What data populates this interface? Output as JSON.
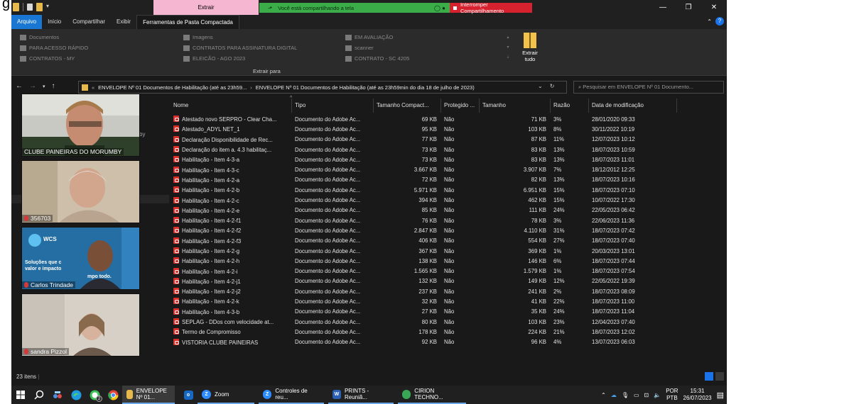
{
  "titlebar": {
    "context_tab": "Extrair",
    "sharing_text": "Você está compartilhando a tela",
    "stop_sharing": "Interromper Compartilhamento"
  },
  "ribbon_tabs": [
    "Arquivo",
    "Início",
    "Compartilhar",
    "Exibir",
    "Ferramentas de Pasta Compactada"
  ],
  "ribbon": {
    "locations_col1": [
      "Documentos",
      "PARA ACESSO RÁPIDO",
      "CONTRATOS - MY"
    ],
    "locations_col2": [
      "Imagens",
      "CONTRATOS PARA ASSINATURA DIGITAL",
      "ELEICÃO - AGO 2023"
    ],
    "locations_col3": [
      "EM AVALIAÇÃO",
      "scanner",
      "CONTRATO - SC 4205"
    ],
    "extract_all": "Extrair tudo",
    "group_caption": "Extrair para"
  },
  "address": {
    "path_part1": "ENVELOPE Nº 01 Documentos de Habilitação (até as 23h59...",
    "path_part2": "ENVELOPE Nº 01 Documentos de Habilitação (até as 23h59min do dia 18 de julho de 2023)",
    "search_placeholder": "Pesquisar em ENVELOPE Nº 01 Documento..."
  },
  "nav_fragments": [
    "by"
  ],
  "participants": [
    {
      "name": "CLUBE PAINEIRAS DO MORUMBY"
    },
    {
      "name": "356703"
    },
    {
      "name": "Carlos Trindade",
      "slide_text1": "WCS",
      "slide_text2": "Soluções que c",
      "slide_text3": "valor e impacto",
      "slide_text4": "mpo todo."
    },
    {
      "name": "sandra Pizzol"
    }
  ],
  "columns": [
    "Nome",
    "Tipo",
    "Tamanho Compact...",
    "Protegido ...",
    "Tamanho",
    "Razão",
    "Data de modificação"
  ],
  "files": [
    {
      "name": "Atestado novo SERPRO - Clear Cha...",
      "type": "Documento do Adobe Ac...",
      "compressed": "69 KB",
      "protected": "Não",
      "size": "71 KB",
      "ratio": "3%",
      "modified": "28/01/2020 09:33"
    },
    {
      "name": "Atestado_ADYL NET_1",
      "type": "Documento do Adobe Ac...",
      "compressed": "95 KB",
      "protected": "Não",
      "size": "103 KB",
      "ratio": "8%",
      "modified": "30/11/2022 10:19"
    },
    {
      "name": "Declaração Disponibilidade de Rec...",
      "type": "Documento do Adobe Ac...",
      "compressed": "77 KB",
      "protected": "Não",
      "size": "87 KB",
      "ratio": "11%",
      "modified": "12/07/2023 10:12"
    },
    {
      "name": "Declaração do item a. 4.3 habilitaç...",
      "type": "Documento do Adobe Ac...",
      "compressed": "73 KB",
      "protected": "Não",
      "size": "83 KB",
      "ratio": "13%",
      "modified": "18/07/2023 10:59"
    },
    {
      "name": "Habilitação - Item 4-3-a",
      "type": "Documento do Adobe Ac...",
      "compressed": "73 KB",
      "protected": "Não",
      "size": "83 KB",
      "ratio": "13%",
      "modified": "18/07/2023 11:01"
    },
    {
      "name": "Habilitação - Item 4-3-c",
      "type": "Documento do Adobe Ac...",
      "compressed": "3.667 KB",
      "protected": "Não",
      "size": "3.907 KB",
      "ratio": "7%",
      "modified": "18/12/2012 12:25"
    },
    {
      "name": "Habilitação - Item 4-2-a",
      "type": "Documento do Adobe Ac...",
      "compressed": "72 KB",
      "protected": "Não",
      "size": "82 KB",
      "ratio": "13%",
      "modified": "18/07/2023 10:16"
    },
    {
      "name": "Habilitação - Item 4-2-b",
      "type": "Documento do Adobe Ac...",
      "compressed": "5.971 KB",
      "protected": "Não",
      "size": "6.951 KB",
      "ratio": "15%",
      "modified": "18/07/2023 07:10"
    },
    {
      "name": "Habilitação - Item 4-2-c",
      "type": "Documento do Adobe Ac...",
      "compressed": "394 KB",
      "protected": "Não",
      "size": "462 KB",
      "ratio": "15%",
      "modified": "10/07/2022 17:30"
    },
    {
      "name": "Habilitação - Item 4-2-e",
      "type": "Documento do Adobe Ac...",
      "compressed": "85 KB",
      "protected": "Não",
      "size": "111 KB",
      "ratio": "24%",
      "modified": "22/05/2023 06:42"
    },
    {
      "name": "Habilitação - Item 4-2-f1",
      "type": "Documento do Adobe Ac...",
      "compressed": "76 KB",
      "protected": "Não",
      "size": "78 KB",
      "ratio": "3%",
      "modified": "22/06/2023 11:36"
    },
    {
      "name": "Habilitação - Item 4-2-f2",
      "type": "Documento do Adobe Ac...",
      "compressed": "2.847 KB",
      "protected": "Não",
      "size": "4.110 KB",
      "ratio": "31%",
      "modified": "18/07/2023 07:42"
    },
    {
      "name": "Habilitação - Item 4-2-f3",
      "type": "Documento do Adobe Ac...",
      "compressed": "406 KB",
      "protected": "Não",
      "size": "554 KB",
      "ratio": "27%",
      "modified": "18/07/2023 07:40"
    },
    {
      "name": "Habilitação - Item 4-2-g",
      "type": "Documento do Adobe Ac...",
      "compressed": "367 KB",
      "protected": "Não",
      "size": "369 KB",
      "ratio": "1%",
      "modified": "20/03/2023 13:01"
    },
    {
      "name": "Habilitação - Item 4-2-h",
      "type": "Documento do Adobe Ac...",
      "compressed": "138 KB",
      "protected": "Não",
      "size": "146 KB",
      "ratio": "6%",
      "modified": "18/07/2023 07:44"
    },
    {
      "name": "Habilitação - Item 4-2-i",
      "type": "Documento do Adobe Ac...",
      "compressed": "1.565 KB",
      "protected": "Não",
      "size": "1.579 KB",
      "ratio": "1%",
      "modified": "18/07/2023 07:54"
    },
    {
      "name": "Habilitação - Item 4-2-j1",
      "type": "Documento do Adobe Ac...",
      "compressed": "132 KB",
      "protected": "Não",
      "size": "149 KB",
      "ratio": "12%",
      "modified": "22/05/2022 19:39"
    },
    {
      "name": "Habilitação - Item 4-2-j2",
      "type": "Documento do Adobe Ac...",
      "compressed": "237 KB",
      "protected": "Não",
      "size": "241 KB",
      "ratio": "2%",
      "modified": "18/07/2023 08:09"
    },
    {
      "name": "Habilitação - Item 4-2-k",
      "type": "Documento do Adobe Ac...",
      "compressed": "32 KB",
      "protected": "Não",
      "size": "41 KB",
      "ratio": "22%",
      "modified": "18/07/2023 11:00"
    },
    {
      "name": "Habilitação - Item 4-3-b",
      "type": "Documento do Adobe Ac...",
      "compressed": "27 KB",
      "protected": "Não",
      "size": "35 KB",
      "ratio": "24%",
      "modified": "18/07/2023 11:04"
    },
    {
      "name": "SEPLAG - DDos com velocidade at...",
      "type": "Documento do Adobe Ac...",
      "compressed": "80 KB",
      "protected": "Não",
      "size": "103 KB",
      "ratio": "23%",
      "modified": "12/04/2023 07:40"
    },
    {
      "name": "Termo de Compromisso",
      "type": "Documento do Adobe Ac...",
      "compressed": "178 KB",
      "protected": "Não",
      "size": "224 KB",
      "ratio": "21%",
      "modified": "18/07/2023 12:02"
    },
    {
      "name": "VISTORIA CLUBE PAINEIRAS",
      "type": "Documento do Adobe Ac...",
      "compressed": "92 KB",
      "protected": "Não",
      "size": "96 KB",
      "ratio": "4%",
      "modified": "13/07/2023 06:03"
    }
  ],
  "status": {
    "count": "23 itens"
  },
  "taskbar": {
    "apps": [
      "ENVELOPE Nº 01...",
      "Zoom",
      "Controles de reu...",
      "PRINTS - Reuniã...",
      "CIRION TECHNO..."
    ],
    "teams_badge": "2",
    "lang1": "POR",
    "lang2": "PTB",
    "time": "15:31",
    "date": "26/07/2023"
  },
  "colors": {
    "accent": "#1977d3",
    "context_tab": "#f4b6d0",
    "sharing_green": "#3aad48",
    "stop_red": "#d6212e"
  }
}
